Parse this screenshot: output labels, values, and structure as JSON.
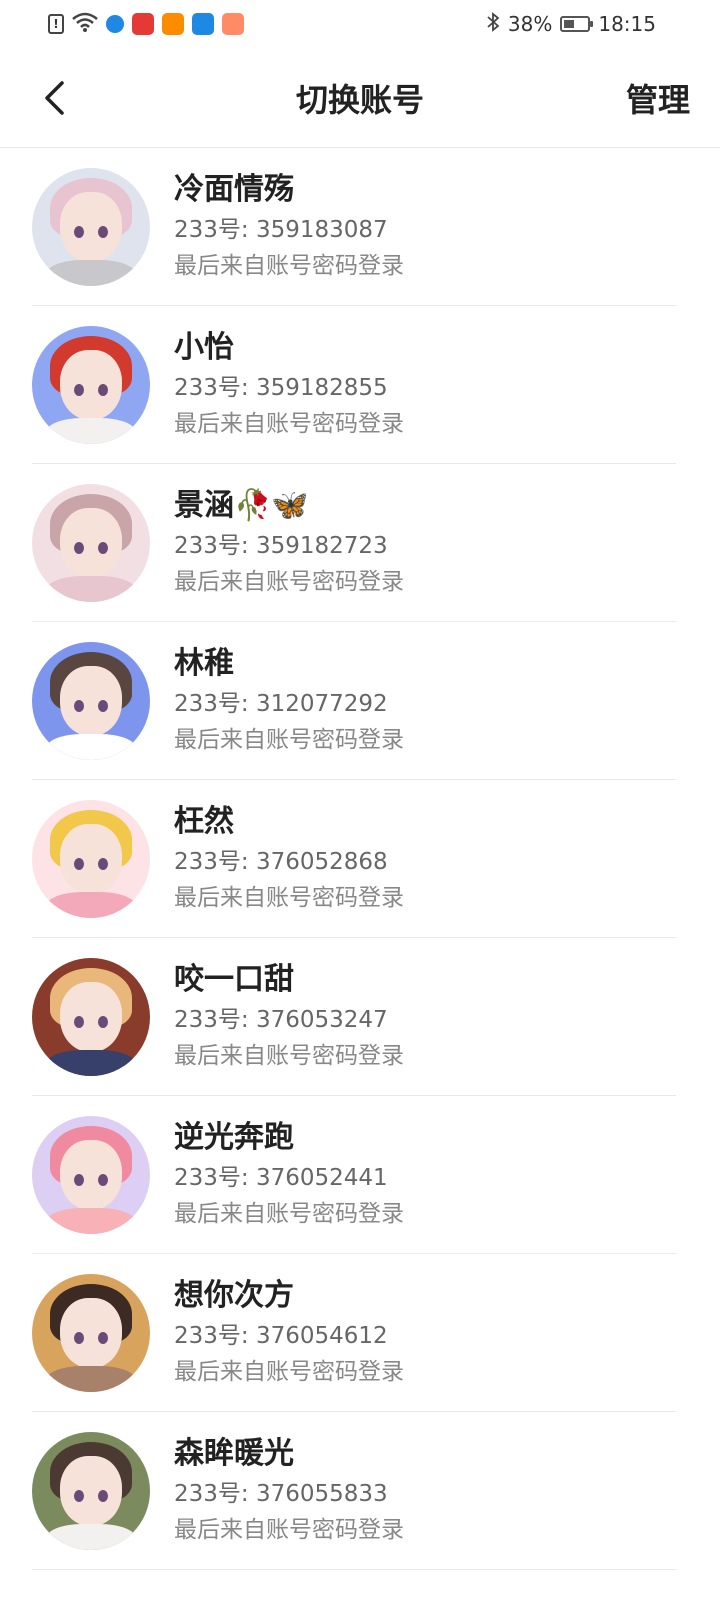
{
  "status_bar": {
    "battery": "38%",
    "time": "18:15",
    "app_colors": [
      "#1e88e5",
      "#e53935",
      "#fb8c00",
      "#1e88e5",
      "#ff8a65"
    ]
  },
  "header": {
    "title": "切换账号",
    "manage": "管理"
  },
  "accounts": [
    {
      "name": "冷面情殇",
      "uid": "233号: 359183087",
      "login": "最后来自账号密码登录",
      "hair": "#e7c4cf",
      "bg": "#dfe3ee",
      "body": "#c7c7cc"
    },
    {
      "name": "小怡",
      "uid": "233号: 359182855",
      "login": "最后来自账号密码登录",
      "hair": "#d23a2e",
      "bg": "#8fa7f2",
      "body": "#f3f1ef"
    },
    {
      "name": "景涵🥀🦋",
      "uid": "233号: 359182723",
      "login": "最后来自账号密码登录",
      "hair": "#c9a4a8",
      "bg": "#f2dfe4",
      "body": "#e7c6cf"
    },
    {
      "name": "林稚",
      "uid": "233号: 312077292",
      "login": "最后来自账号密码登录",
      "hair": "#5a4640",
      "bg": "#7e95ee",
      "body": "#ffffff"
    },
    {
      "name": "枉然",
      "uid": "233号: 376052868",
      "login": "最后来自账号密码登录",
      "hair": "#f2c84a",
      "bg": "#fde3e6",
      "body": "#f4a9ba"
    },
    {
      "name": "咬一口甜",
      "uid": "233号: 376053247",
      "login": "最后来自账号密码登录",
      "hair": "#e9b779",
      "bg": "#8a3c2c",
      "body": "#36406a"
    },
    {
      "name": "逆光奔跑",
      "uid": "233号: 376052441",
      "login": "最后来自账号密码登录",
      "hair": "#f08aa0",
      "bg": "#dccff3",
      "body": "#f7b1b7"
    },
    {
      "name": "想你次方",
      "uid": "233号: 376054612",
      "login": "最后来自账号密码登录",
      "hair": "#3c2a23",
      "bg": "#d8a35d",
      "body": "#a7816a"
    },
    {
      "name": "森眸暖光",
      "uid": "233号: 376055833",
      "login": "最后来自账号密码登录",
      "hair": "#4b3a31",
      "bg": "#7c8b5d",
      "body": "#f2f1ef"
    }
  ]
}
